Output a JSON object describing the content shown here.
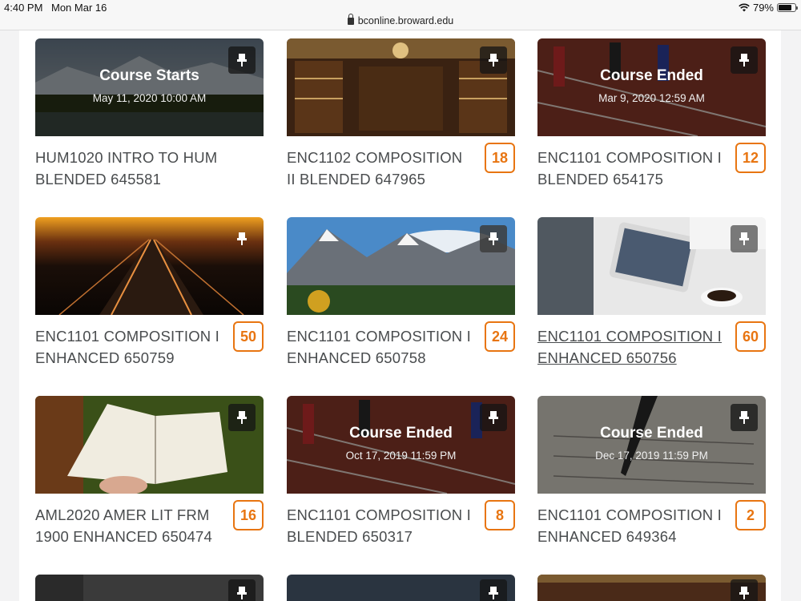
{
  "status_bar": {
    "time": "4:40 PM",
    "date": "Mon Mar 16",
    "url": "bconline.broward.edu",
    "battery": "79%",
    "battery_level": 0.79
  },
  "courses": [
    {
      "title": "HUM1020 INTRO TO HUM BLENDED 645581",
      "overlay_title": "Course Starts",
      "overlay_date": "May 11, 2020 10:00 AM",
      "badge": "",
      "image": "mountain-lake"
    },
    {
      "title": "ENC1102 COMPOSITION II BLENDED 647965",
      "overlay_title": "",
      "overlay_date": "",
      "badge": "18",
      "image": "library"
    },
    {
      "title": "ENC1101 COMPOSITION I BLENDED 654175",
      "overlay_title": "Course Ended",
      "overlay_date": "Mar 9, 2020 12:59 AM",
      "badge": "12",
      "image": "running-track"
    },
    {
      "title": "ENC1101 COMPOSITION I ENHANCED 650759",
      "overlay_title": "",
      "overlay_date": "",
      "badge": "50",
      "image": "railroad-sunset"
    },
    {
      "title": "ENC1101 COMPOSITION I ENHANCED 650758",
      "overlay_title": "",
      "overlay_date": "",
      "badge": "24",
      "image": "mountains"
    },
    {
      "title": "ENC1101 COMPOSITION I ENHANCED 650756",
      "overlay_title": "",
      "overlay_date": "",
      "badge": "60",
      "image": "tablet"
    },
    {
      "title": "AML2020 AMER LIT FRM 1900 ENHANCED 650474",
      "overlay_title": "",
      "overlay_date": "",
      "badge": "16",
      "image": "open-book"
    },
    {
      "title": "ENC1101 COMPOSITION I BLENDED 650317",
      "overlay_title": "Course Ended",
      "overlay_date": "Oct 17, 2019 11:59 PM",
      "badge": "8",
      "image": "running-track"
    },
    {
      "title": "ENC1101 COMPOSITION I ENHANCED 649364",
      "overlay_title": "Course Ended",
      "overlay_date": "Dec 17, 2019 11:59 PM",
      "badge": "2",
      "image": "writing"
    }
  ],
  "pin_icon": "pin-icon",
  "colors": {
    "badge": "#e87511",
    "text": "#494c4e"
  }
}
